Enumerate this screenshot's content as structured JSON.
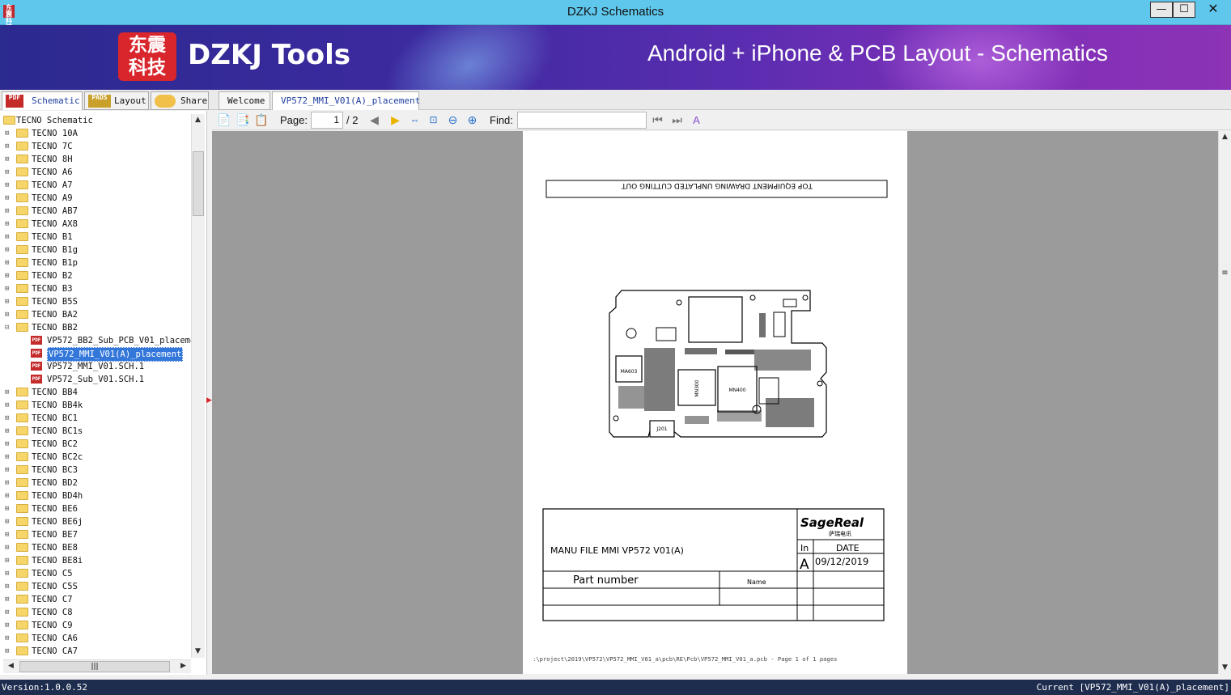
{
  "window": {
    "title": "DZKJ Schematics",
    "icon_text": "东震科技",
    "minimize": "—",
    "maximize": "☐",
    "close": "✕"
  },
  "banner": {
    "logo_text": "东震科技",
    "brand": "DZKJ Tools",
    "tagline": "Android + iPhone & PCB Layout - Schematics"
  },
  "left_tabs": [
    {
      "label": "Schematic",
      "icon": "PDF"
    },
    {
      "label": "Layout",
      "icon": "PADS"
    },
    {
      "label": "Share",
      "icon": "cloud-icon"
    }
  ],
  "doc_tabs": [
    {
      "label": "Welcome"
    },
    {
      "label": "VP572_MMI_V01(A)_placement",
      "close": "✕"
    }
  ],
  "tree": {
    "root": "TECNO Schematic",
    "items_before": [
      "TECNO 10A",
      "TECNO 7C",
      "TECNO 8H",
      "TECNO A6",
      "TECNO A7",
      "TECNO A9",
      "TECNO AB7",
      "TECNO AX8",
      "TECNO B1",
      "TECNO B1g",
      "TECNO B1p",
      "TECNO B2",
      "TECNO B3",
      "TECNO B5S",
      "TECNO BA2"
    ],
    "expanded": "TECNO BB2",
    "files": [
      "VP572_BB2_Sub_PCB_V01_placemen",
      "VP572_MMI_V01(A)_placement",
      "VP572_MMI_V01.SCH.1",
      "VP572_Sub_V01.SCH.1"
    ],
    "selected_file_index": 1,
    "items_after": [
      "TECNO BB4",
      "TECNO BB4k",
      "TECNO BC1",
      "TECNO BC1s",
      "TECNO BC2",
      "TECNO BC2c",
      "TECNO BC3",
      "TECNO BD2",
      "TECNO BD4h",
      "TECNO BE6",
      "TECNO BE6j",
      "TECNO BE7",
      "TECNO BE8",
      "TECNO BE8i",
      "TECNO C5",
      "TECNO C5S",
      "TECNO C7",
      "TECNO C8",
      "TECNO C9",
      "TECNO CA6",
      "TECNO CA7"
    ]
  },
  "toolbar": {
    "page_label": "Page:",
    "page_current": "1",
    "page_total": "/ 2",
    "find_label": "Find:",
    "find_value": ""
  },
  "document": {
    "header_text": "TOP EQUIPMENT DRAWING UNPLATED CUTTING OUT",
    "board_labels": [
      "MA603",
      "MN300",
      "MN400",
      "J201"
    ],
    "manu_file": "MANU FILE MMI   VP572   V01(A)",
    "company": "SageReal",
    "company_sub": "萨瑞电讯",
    "rev_header": "In",
    "date_header": "DATE",
    "rev": "A",
    "date": "09/12/2019",
    "part_number": "Part number",
    "name_label": "Name",
    "footer": ":\\project\\2019\\VP572\\VP572_MMI_V01_a\\pcb\\RE\\Pcb\\VP572_MMI_V01_a.pcb - Page 1 of 1 pages"
  },
  "status": {
    "version": "Version:1.0.0.52",
    "current": "Current [VP572_MMI_V01(A)_placement]"
  },
  "colors": {
    "titlebar": "#5fc7ec",
    "banner_start": "#2b2a8f",
    "banner_end": "#8c33b6",
    "logo": "#d8262c",
    "selection": "#3477db",
    "statusbar": "#1e2c4e"
  }
}
